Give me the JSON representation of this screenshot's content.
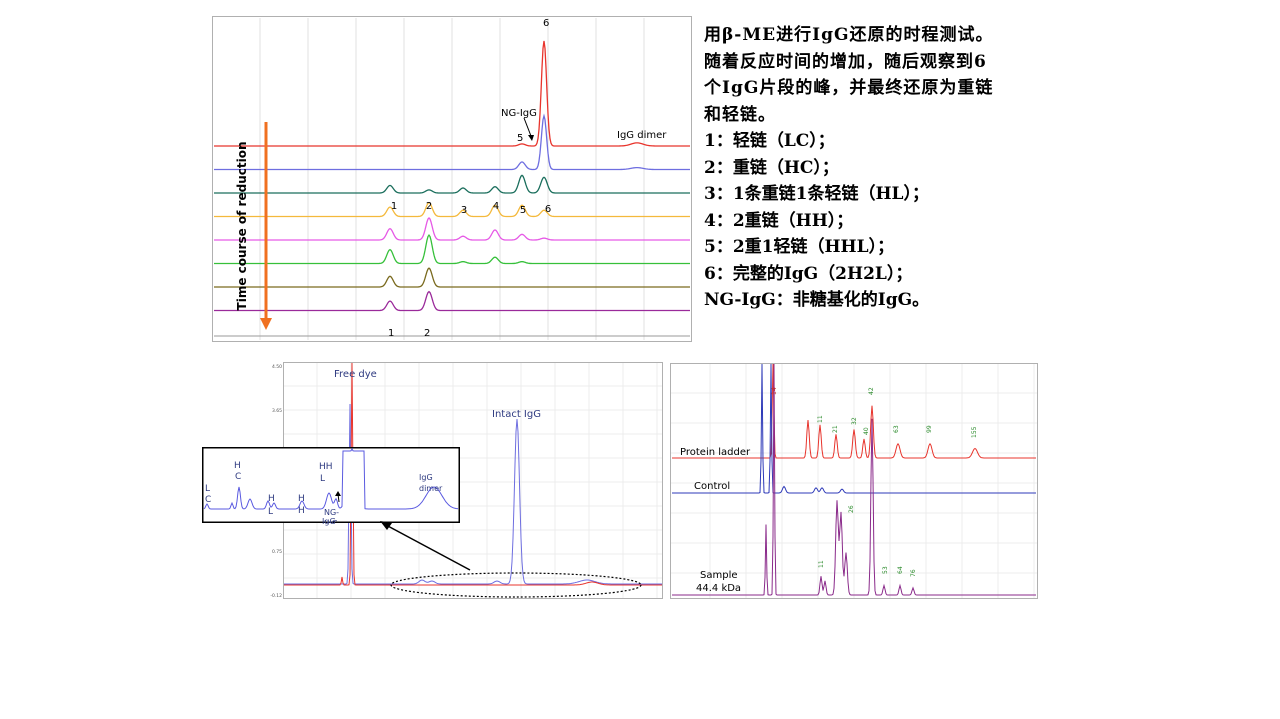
{
  "description": {
    "intro": "用β-ME进行IgG还原的时程测试。随着反应时间的增加，随后观察到6个IgG片段的峰，并最终还原为重链和轻链。",
    "items": [
      "1：轻链（LC）；",
      "2：重链（HC）；",
      "3：1条重链1条轻链（HL）；",
      "4：2重链（HH）；",
      "5：2重1轻链（HHL）；",
      "6：完整的IgG（2H2L）；",
      "NG-IgG：非糖基化的IgG。"
    ]
  },
  "chart_data": [
    {
      "type": "line",
      "ylabel": "Time course of reduction",
      "peak_labels": [
        "1",
        "2",
        "3",
        "4",
        "5",
        "6"
      ],
      "annotations": [
        "NG-IgG",
        "IgG dimer",
        "5",
        "6",
        "1",
        "2"
      ],
      "trace_colors": [
        "#e8342c",
        "#6e6ee0",
        "#1a6e5c",
        "#f4b93c",
        "#e65ae6",
        "#36c03a",
        "#7a6a1e",
        "#9a2a9a"
      ],
      "series": [
        {
          "name": "trace-1",
          "color": "#e8342c",
          "peaks": {
            "5": 0.02,
            "6": 1.0,
            "dimer": 0.03
          }
        },
        {
          "name": "trace-2",
          "color": "#6e6ee0",
          "peaks": {
            "5": 0.12,
            "6": 0.85,
            "dimer": 0.03
          }
        },
        {
          "name": "trace-3",
          "color": "#1a6e5c",
          "peaks": {
            "1": 0.12,
            "2": 0.05,
            "3": 0.08,
            "4": 0.1,
            "5": 0.28,
            "6": 0.25
          }
        },
        {
          "name": "trace-4",
          "color": "#f4b93c",
          "peaks": {
            "1": 0.15,
            "2": 0.22,
            "3": 0.1,
            "4": 0.18,
            "5": 0.18,
            "6": 0.1
          }
        },
        {
          "name": "trace-5",
          "color": "#e65ae6",
          "peaks": {
            "1": 0.18,
            "2": 0.35,
            "3": 0.06,
            "4": 0.16,
            "5": 0.09,
            "6": 0.03
          }
        },
        {
          "name": "trace-6",
          "color": "#36c03a",
          "peaks": {
            "1": 0.22,
            "2": 0.45,
            "3": 0.03,
            "4": 0.1,
            "5": 0.03
          }
        },
        {
          "name": "trace-7",
          "color": "#7a6a1e",
          "peaks": {
            "1": 0.17,
            "2": 0.3
          }
        },
        {
          "name": "trace-8",
          "color": "#9a2a9a",
          "peaks": {
            "1": 0.15,
            "2": 0.3
          }
        }
      ]
    },
    {
      "type": "line",
      "ytick_labels": [
        "4.50",
        "3.65",
        "0.75",
        "-0.12"
      ],
      "annotations": [
        "Free dye",
        "Intact IgG"
      ],
      "inset_labels": [
        "L",
        "C",
        "H",
        "C",
        "H",
        "L",
        "H",
        "H",
        "HH",
        "L",
        "NG-",
        "IgG",
        "IgG",
        "dimer"
      ],
      "series": [
        {
          "name": "red",
          "color": "#e8342c"
        },
        {
          "name": "blue",
          "color": "#6e6ee0"
        }
      ]
    },
    {
      "type": "line",
      "series_labels": [
        "Protein ladder",
        "Control",
        "Sample",
        "44.4 kDa"
      ],
      "ladder_peak_labels": [
        "14",
        "11",
        "21",
        "32",
        "40",
        "42",
        "63",
        "99",
        "155"
      ],
      "sample_peak_labels": [
        "11",
        "26",
        "53",
        "64",
        "76"
      ],
      "series": [
        {
          "name": "Protein ladder",
          "color": "#e8342c"
        },
        {
          "name": "Control",
          "color": "#2e3ab8"
        },
        {
          "name": "Sample",
          "color": "#8a2a8a"
        }
      ]
    }
  ]
}
